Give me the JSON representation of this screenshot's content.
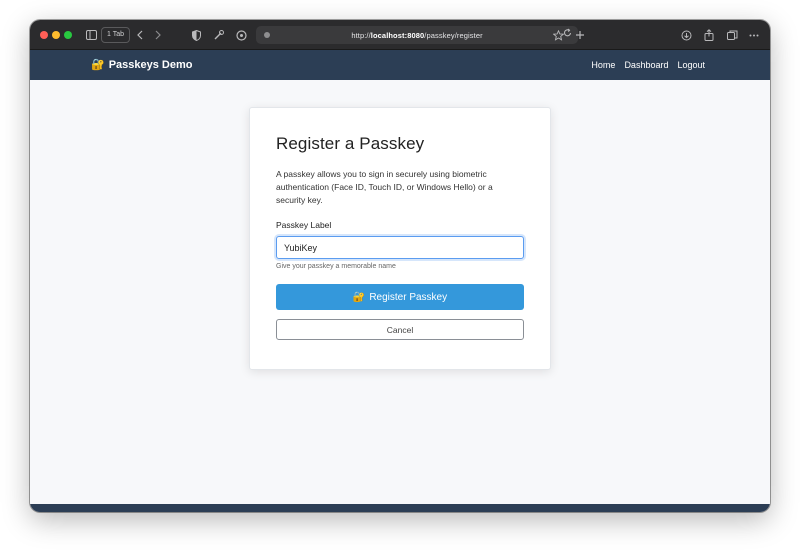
{
  "browser": {
    "tab_count_label": "1 Tab",
    "url_prefix": "http://",
    "url_host": "localhost:8080",
    "url_path": "/passkey/register"
  },
  "navbar": {
    "brand_icon": "🔐",
    "brand_label": "Passkeys Demo",
    "links": [
      "Home",
      "Dashboard",
      "Logout"
    ]
  },
  "card": {
    "title": "Register a Passkey",
    "description": "A passkey allows you to sign in securely using biometric authentication (Face ID, Touch ID, or Windows Hello) or a security key.",
    "field_label": "Passkey Label",
    "field_value": "YubiKey",
    "field_help": "Give your passkey a memorable name",
    "register_icon": "🔐",
    "register_label": "Register Passkey",
    "cancel_label": "Cancel"
  },
  "colors": {
    "navbar": "#2c3e55",
    "primary": "#3498db",
    "focus_ring": "#5b9cf0"
  },
  "icons": {
    "sidebar": "sidebar-icon",
    "back": "chevron-left-icon",
    "forward": "chevron-right-icon",
    "shield": "shield-icon",
    "tools": "tools-icon",
    "extension": "extension-icon",
    "reload": "reload-icon",
    "bookmark": "star-icon",
    "new_tab": "plus-icon",
    "download": "download-icon",
    "share": "share-icon",
    "tabs": "tabs-overview-icon",
    "more": "more-icon"
  }
}
